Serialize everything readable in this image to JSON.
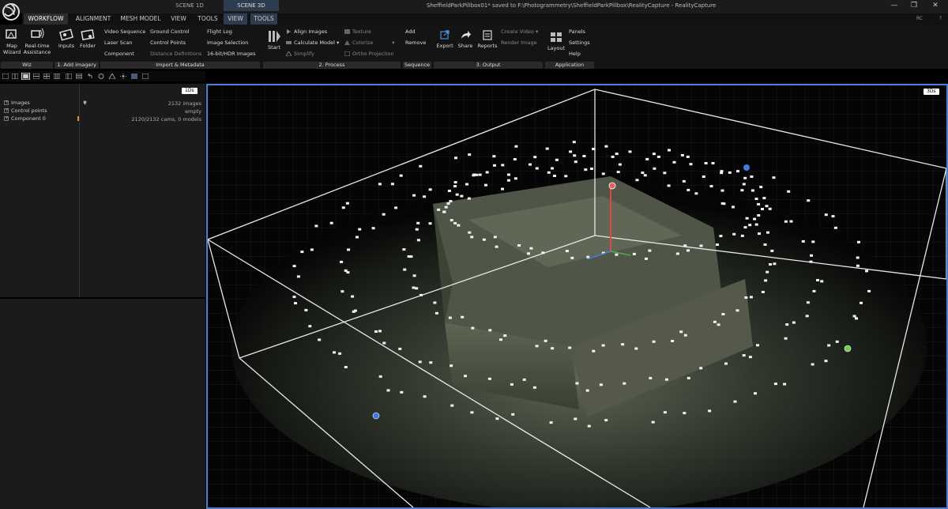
{
  "titlebar": {
    "scene_tabs": [
      "SCENE 1D",
      "SCENE 3D"
    ],
    "title": "SheffieldParkPillbox01* saved to F:\\Photogrammetry\\SheffieldParkPillbox\\RealityCapture - RealityCapture",
    "minimize": "—",
    "maximize": "❐",
    "close": "✕"
  },
  "menu": {
    "items": [
      "WORKFLOW",
      "ALIGNMENT",
      "MESH MODEL",
      "VIEW",
      "TOOLS",
      "VIEW",
      "TOOLS"
    ],
    "rc_label": "RC",
    "help": "?"
  },
  "ribbon": {
    "wiz": {
      "map_wizard": [
        "Map",
        "Wizard"
      ],
      "realtime": [
        "Real-time",
        "Assistance"
      ],
      "group": "Wiz"
    },
    "add_imagery": {
      "inputs": "Inputs",
      "folder": "Folder",
      "group": "1. Add imagery"
    },
    "import": {
      "col1": [
        "Video Sequence",
        "Laser Scan",
        "Component"
      ],
      "col2": [
        "Ground Control",
        "Control Points",
        "Distance Definitions"
      ],
      "col3": [
        "Flight Log",
        "Image Selection",
        "16-bit/HDR Images"
      ],
      "group": "Import & Metadata"
    },
    "process": {
      "start": "Start",
      "col1": [
        "Align Images",
        "Calculate Model",
        "Simplify"
      ],
      "col2": [
        "Texture",
        "Colorize",
        "Ortho Projection"
      ],
      "group": "2. Process"
    },
    "sequence": {
      "items": [
        "Add",
        "Remove"
      ],
      "group": "Sequence"
    },
    "output": {
      "export": "Export",
      "share": "Share",
      "reports": "Reports",
      "col": [
        "Create Video",
        "Render Image"
      ],
      "group": "3. Output"
    },
    "application": {
      "layout": "Layout",
      "col": [
        "Panels",
        "Settings",
        "Help"
      ],
      "group": "Application"
    }
  },
  "left_panel": {
    "tag": "1Ds",
    "tree": [
      "Images",
      "Control points",
      "Component 0"
    ],
    "values": [
      "2132 images",
      "empty",
      "2120/2132 cams, 0 models"
    ]
  },
  "viewport": {
    "tag": "3Ds"
  },
  "colors": {
    "accent": "#4a7fd6",
    "bg": "#050505",
    "panel": "#1b1b1b"
  }
}
